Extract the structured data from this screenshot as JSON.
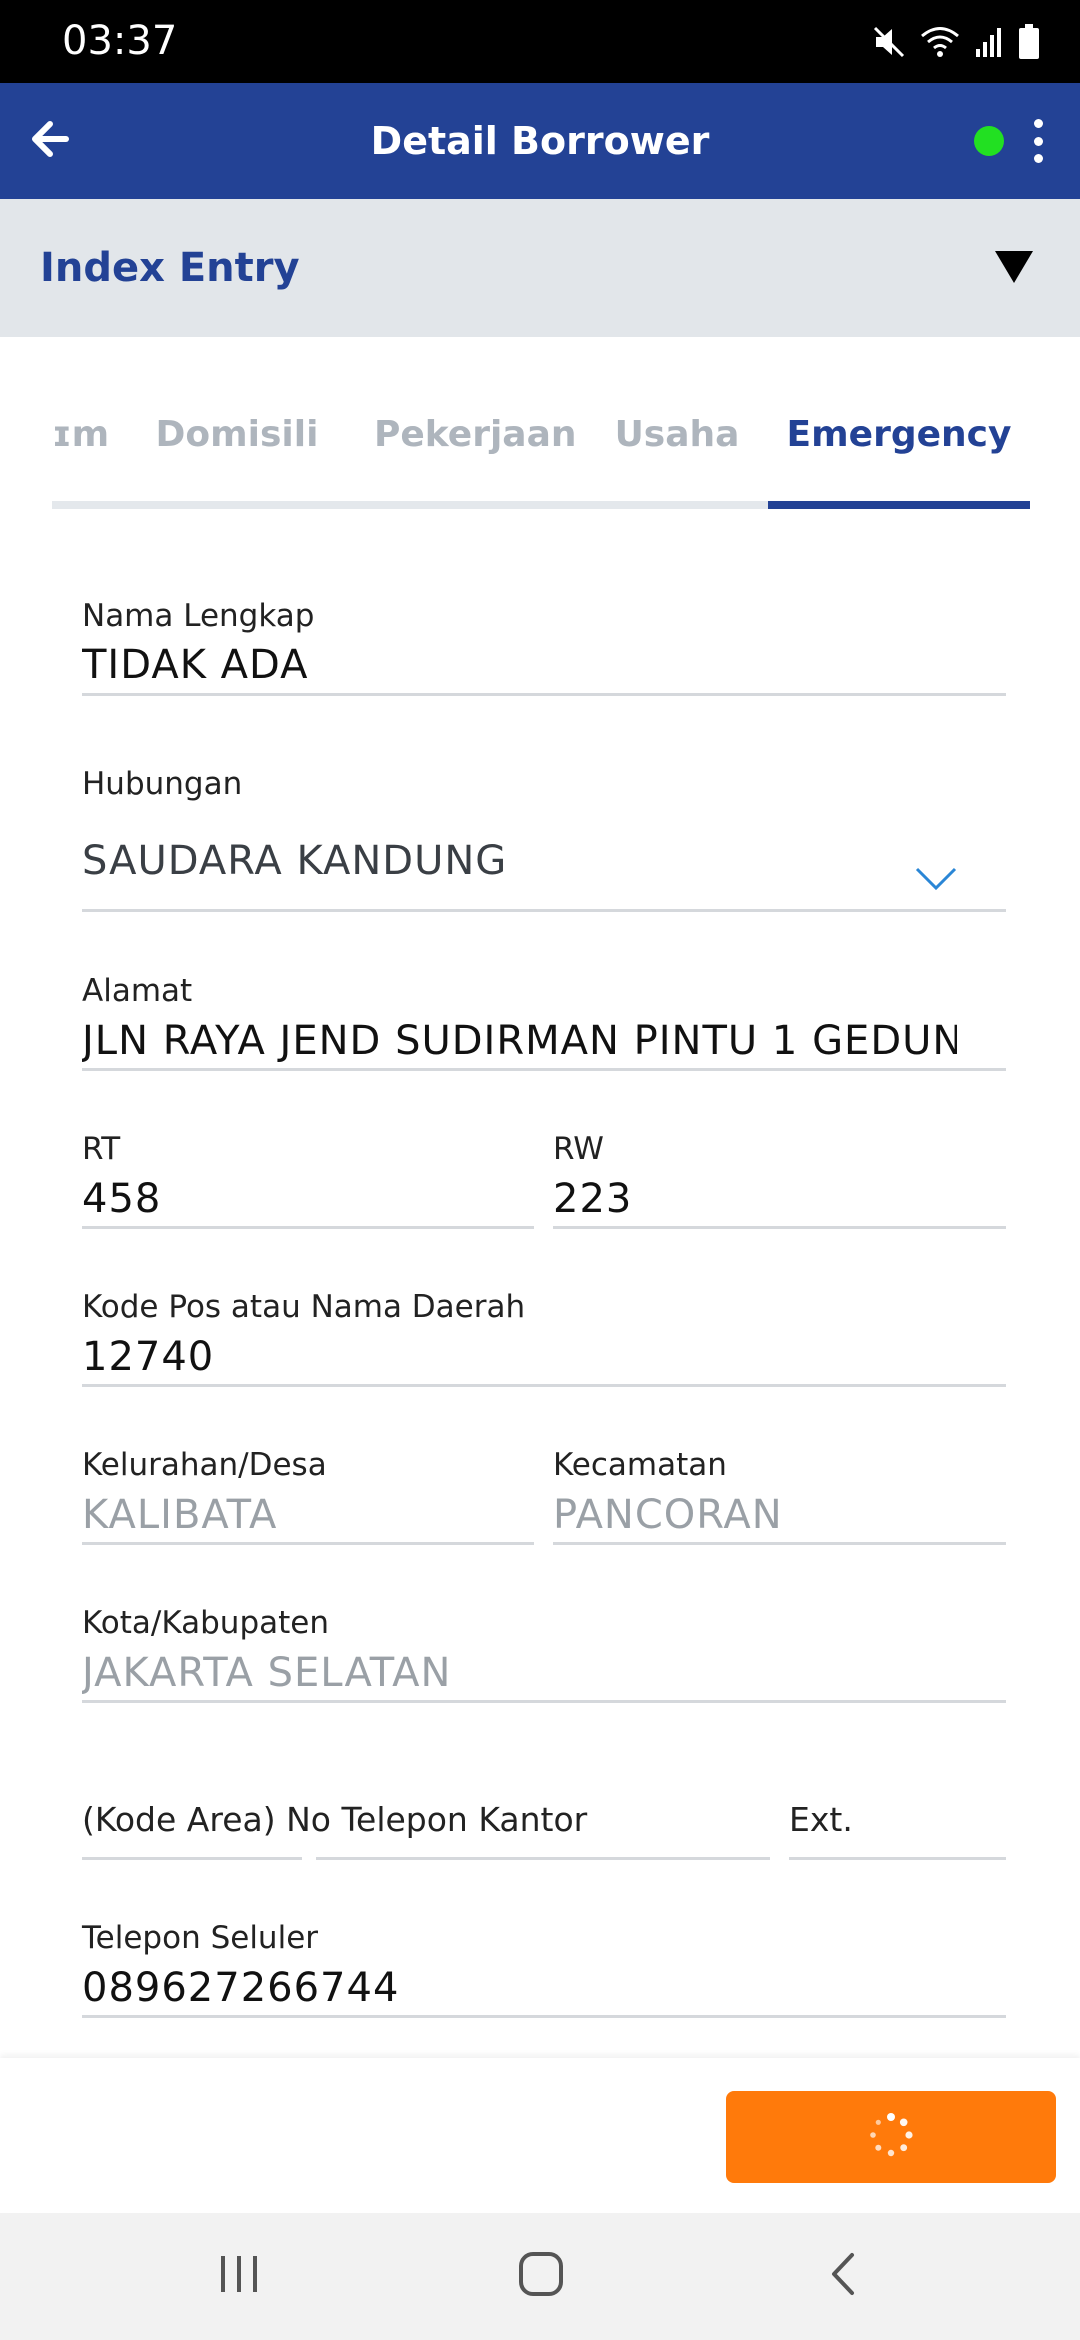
{
  "status_bar": {
    "time": "03:37",
    "icons": [
      "mute-icon",
      "wifi-icon",
      "signal-icon",
      "battery-icon"
    ]
  },
  "app_bar": {
    "title": "Detail Borrower",
    "back_icon": "arrow-left-icon",
    "menu_icon": "more-vertical-icon",
    "status_color": "#22e022"
  },
  "section": {
    "title": "Index Entry",
    "toggle_icon": "triangle-down-icon"
  },
  "tabs": [
    {
      "label": "ɪm",
      "active": false
    },
    {
      "label": "Domisili",
      "active": false
    },
    {
      "label": "Pekerjaan",
      "active": false
    },
    {
      "label": "Usaha",
      "active": false
    },
    {
      "label": "Emergency",
      "active": true
    }
  ],
  "form": {
    "nama_lengkap": {
      "label": "Nama Lengkap",
      "value": "TIDAK ADA"
    },
    "hubungan": {
      "label": "Hubungan",
      "value": "SAUDARA KANDUNG"
    },
    "alamat": {
      "label": "Alamat",
      "value": "JLN RAYA JEND SUDIRMAN PINTU 1 GEDUN"
    },
    "rt": {
      "label": "RT",
      "value": "458"
    },
    "rw": {
      "label": "RW",
      "value": "223"
    },
    "kode_pos": {
      "label": "Kode Pos atau Nama Daerah",
      "value": "12740"
    },
    "kelurahan": {
      "label": "Kelurahan/Desa",
      "value": "KALIBATA"
    },
    "kecamatan": {
      "label": "Kecamatan",
      "value": "PANCORAN"
    },
    "kota": {
      "label": "Kota/Kabupaten",
      "value": "JAKARTA SELATAN"
    },
    "telepon_kantor": {
      "label": "(Kode Area) No Telepon Kantor"
    },
    "ext": {
      "label": "Ext."
    },
    "telepon_seluler": {
      "label": "Telepon Seluler",
      "value": "089627266744"
    }
  },
  "action": {
    "button_state": "loading",
    "button_color": "#ff7a0b"
  },
  "colors": {
    "primary": "#234295",
    "accent": "#ff7a0b"
  },
  "nav_bar": {
    "buttons": [
      "recent-apps-icon",
      "home-icon",
      "back-icon"
    ]
  }
}
